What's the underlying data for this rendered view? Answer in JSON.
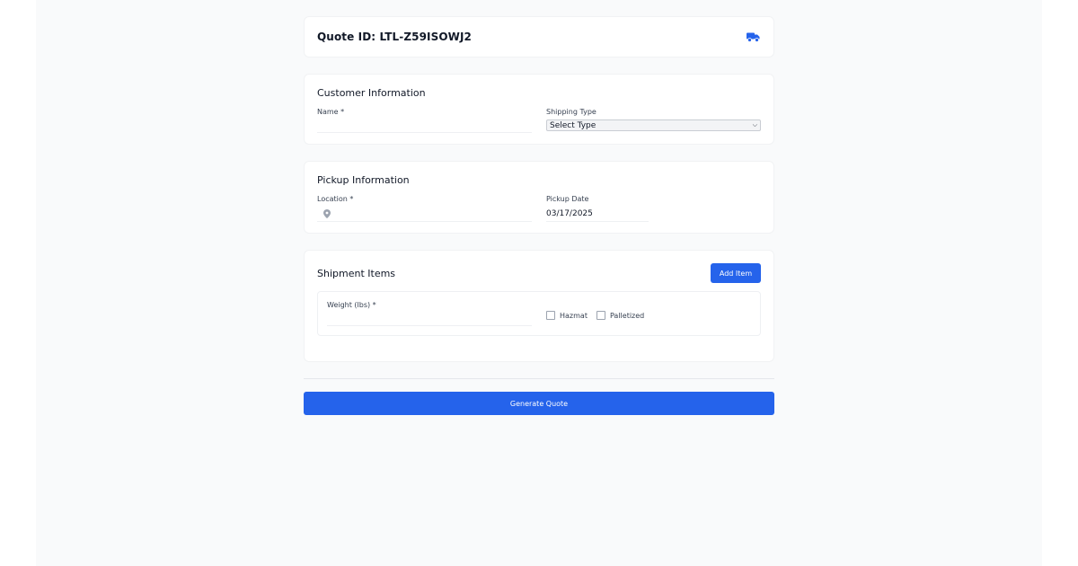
{
  "header": {
    "title": "Quote ID: LTL-Z59ISOWJ2",
    "icon": "truck-icon"
  },
  "customer": {
    "section_title": "Customer Information",
    "name_label": "Name *",
    "name_value": "",
    "shipping_type_label": "Shipping Type",
    "shipping_type_value": "Select Type"
  },
  "pickup": {
    "section_title": "Pickup Information",
    "location_label": "Location *",
    "location_value": "",
    "location_icon": "map-pin-icon",
    "date_label": "Pickup Date",
    "date_value": "03/17/2025"
  },
  "items": {
    "section_title": "Shipment Items",
    "add_label": "Add Item",
    "weight_label": "Weight (lbs) *",
    "weight_value": "",
    "hazmat_label": "Hazmat",
    "palletized_label": "Palletized"
  },
  "actions": {
    "generate_label": "Generate Quote"
  },
  "colors": {
    "accent": "#2563eb",
    "background": "#f9fafb"
  }
}
